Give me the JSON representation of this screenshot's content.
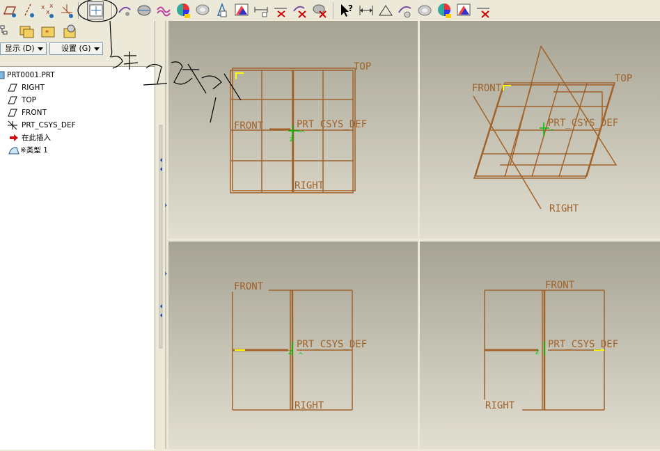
{
  "toolbar": {
    "buttons": [
      "datum-plane-display-icon",
      "datum-axis-display-icon",
      "datum-point-display-icon",
      "coordinate-system-display-icon",
      "annotation-display-icon",
      "style-icon",
      "shade-icon",
      "curve-icon",
      "color-icon",
      "render-icon",
      "model-tree-icon",
      "appearance-icon",
      "measure-icon",
      "analysis-icon",
      "delete-icon",
      "delete2-icon",
      "help-icon",
      "dimension-icon",
      "ruler-icon",
      "reference-icon",
      "shade2-icon",
      "color2-icon",
      "appearance2-icon",
      "measure2-icon"
    ]
  },
  "navigator": {
    "display_label": "显示 (D)",
    "settings_label": "设置 (G)"
  },
  "model_tree": {
    "root": "PRT0001.PRT",
    "items": [
      {
        "label": "RIGHT",
        "icon": "datum-plane-icon"
      },
      {
        "label": "TOP",
        "icon": "datum-plane-icon"
      },
      {
        "label": "FRONT",
        "icon": "datum-plane-icon"
      },
      {
        "label": "PRT_CSYS_DEF",
        "icon": "csys-icon"
      },
      {
        "label": "在此插入",
        "icon": "insert-arrow-icon"
      },
      {
        "label": "※类型 1",
        "icon": "type-icon"
      }
    ]
  },
  "viewports": {
    "top_left": {
      "top": "TOP",
      "front": "FRONT",
      "csys": "PRT_CSYS_DEF",
      "right": "RIGHT"
    },
    "top_right": {
      "front": "FRONT",
      "top": "TOP",
      "csys": "PRT_CSYS_DEF",
      "right": "RIGHT"
    },
    "bottom_left": {
      "front": "FRONT",
      "csys": "PRT_CSYS_DEF",
      "right": "RIGHT"
    },
    "bottom_right": {
      "front": "FRONT",
      "csys": "PRT_CSYS_DEF",
      "right": "RIGHT"
    }
  },
  "colors": {
    "datum": "#a0622a",
    "csys": "#00c000",
    "highlight": "#ffff00"
  }
}
